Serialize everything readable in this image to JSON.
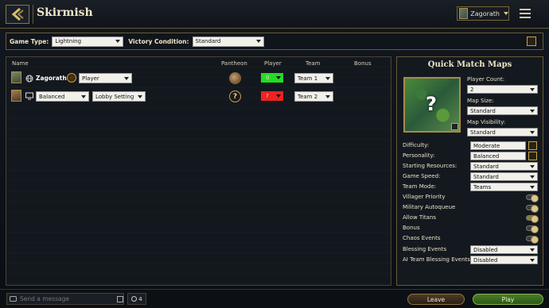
{
  "header": {
    "title": "Skirmish",
    "profile_name": "Zagorath"
  },
  "filters": {
    "game_type_label": "Game Type:",
    "game_type_value": "Lightning",
    "victory_label": "Victory Condition:",
    "victory_value": "Standard"
  },
  "players_table": {
    "columns": [
      "Name",
      "Pantheon",
      "Player",
      "Team",
      "Bonus"
    ],
    "rows": [
      {
        "name": "Zagorath",
        "type_value": "Player",
        "player_number": "0",
        "player_color": "#22dd22",
        "team": "Team 1",
        "pantheon": "pantheon-portrait"
      },
      {
        "name_value": "Balanced",
        "type_value": "Lobby Setting",
        "player_number": "?",
        "player_color": "#ee2222",
        "team": "Team 2",
        "pantheon": "pantheon-unknown",
        "pantheon_symbol": "?"
      }
    ]
  },
  "quick_match": {
    "title": "Quick Match Maps",
    "map_symbol": "?",
    "player_count_label": "Player Count:",
    "player_count_value": "2",
    "map_size_label": "Map Size:",
    "map_size_value": "Standard",
    "map_visibility_label": "Map Visibility:",
    "map_visibility_value": "Standard",
    "settings": [
      {
        "label": "Difficulty:",
        "value": "Moderate"
      },
      {
        "label": "Personality:",
        "value": "Balanced"
      },
      {
        "label": "Starting Resources:",
        "value": "Standard"
      },
      {
        "label": "Game Speed:",
        "value": "Standard"
      },
      {
        "label": "Team Mode:",
        "value": "Teams"
      }
    ],
    "toggles": [
      {
        "label": "Villager Priority",
        "on": false
      },
      {
        "label": "Military Autoqueue",
        "on": false
      },
      {
        "label": "Allow Titans",
        "on": true
      },
      {
        "label": "Bonus",
        "on": false
      },
      {
        "label": "Chaos Events",
        "on": false
      }
    ],
    "blessing_events_label": "Blessing Events",
    "blessing_events_value": "Disabled",
    "ai_blessing_label": "AI Team Blessing Events",
    "ai_blessing_value": "Disabled"
  },
  "bottom": {
    "chat_placeholder": "Send a message",
    "user_count": "4",
    "leave_label": "Leave",
    "play_label": "Play"
  }
}
